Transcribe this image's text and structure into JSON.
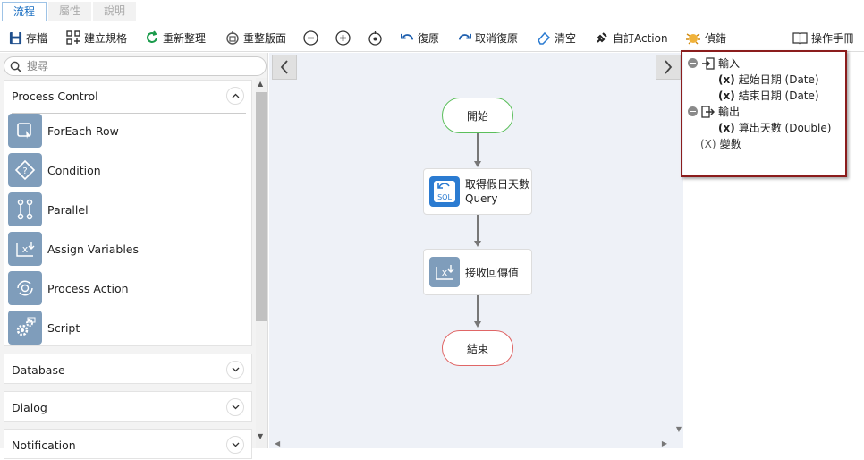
{
  "tabs": [
    {
      "label": "流程"
    },
    {
      "label": "屬性"
    },
    {
      "label": "說明"
    }
  ],
  "toolbar": {
    "save": "存檔",
    "build_spec": "建立規格",
    "reorganize": "重新整理",
    "relayout": "重整版面",
    "undo": "復原",
    "redo": "取消復原",
    "clear": "清空",
    "custom_action": "自訂Action",
    "debug": "偵錯",
    "manual": "操作手冊"
  },
  "sidebar": {
    "search_placeholder": "搜尋",
    "process_control": {
      "title": "Process Control",
      "items": [
        {
          "label": "ForEach Row",
          "icon": "foreach-row-icon"
        },
        {
          "label": "Condition",
          "icon": "condition-icon"
        },
        {
          "label": "Parallel",
          "icon": "parallel-icon"
        },
        {
          "label": "Assign Variables",
          "icon": "assign-variables-icon"
        },
        {
          "label": "Process Action",
          "icon": "process-action-icon"
        },
        {
          "label": "Script",
          "icon": "script-icon"
        }
      ]
    },
    "sections": [
      {
        "title": "Database"
      },
      {
        "title": "Dialog"
      },
      {
        "title": "Notification"
      }
    ]
  },
  "flow": {
    "start": "開始",
    "step1": {
      "line1": "取得假日天數",
      "line2": "Query"
    },
    "step2": "接收回傳值",
    "end": "結束"
  },
  "variables": {
    "input": {
      "label": "輸入",
      "items": [
        "起始日期 (Date)",
        "結束日期 (Date)"
      ]
    },
    "output": {
      "label": "輸出",
      "items": [
        "算出天數 (Double)"
      ]
    },
    "vars_label": "變數",
    "x_marker": "(x)",
    "x_marker_upper": "(X)"
  },
  "colors": {
    "accent": "#1a6fc2",
    "start_border": "#5bbf5b",
    "end_border": "#e06666",
    "frame": "#8b1d1d",
    "node_icon": "#7f9dbb"
  }
}
